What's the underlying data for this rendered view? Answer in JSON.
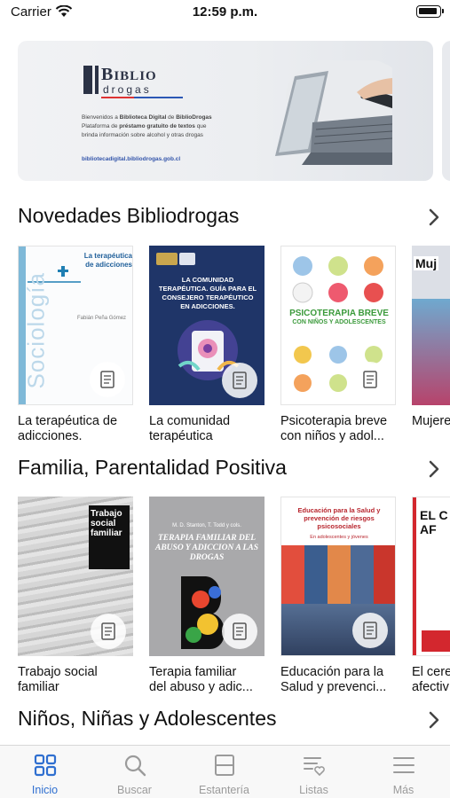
{
  "status_bar": {
    "carrier": "Carrier",
    "time": "12:59 p.m."
  },
  "banner": {
    "logo_title": "IBLIO",
    "logo_prefix": "B",
    "logo_sub": "drogas",
    "text_line1_a": "Bienvenidos a ",
    "text_line1_b": "Biblioteca Digital",
    "text_line1_c": " de ",
    "text_line1_d": "BiblioDrogas",
    "text_line2_a": "Plataforma de ",
    "text_line2_b": "préstamo gratuito de textos",
    "text_line2_c": " que",
    "text_line3": "brinda información sobre alcohol y otras drogas",
    "url": "bibliotecadigital.bibliodrogas.gob.cl"
  },
  "sections": [
    {
      "title": "Novedades Bibliodrogas",
      "books": [
        {
          "line1": "La terapéutica de",
          "line2": "adicciones.",
          "cover_title": "La terapéutica de adicciones",
          "cover_side": "Sociología",
          "cover_author": "Fabián Peña Gómez"
        },
        {
          "line1": "La comunidad",
          "line2": "terapéutica",
          "cover_title": "LA COMUNIDAD TERAPÉUTICA. GUÍA PARA EL CONSEJERO TERAPÉUTICO EN ADICCIONES."
        },
        {
          "line1": "Psicoterapia breve",
          "line2": "con niños y adol...",
          "cover_title": "PSICOTERAPIA BREVE",
          "cover_subtitle": "CON NIÑOS Y ADOLESCENTES"
        },
        {
          "line1": "Mujere",
          "line2": "",
          "cover_title": "Muj"
        }
      ]
    },
    {
      "title": "Familia, Parentalidad Positiva",
      "books": [
        {
          "line1": "Trabajo social",
          "line2": "familiar",
          "cover_title": "Trabajo social familiar"
        },
        {
          "line1": "Terapia familiar",
          "line2": "del abuso y adic...",
          "cover_title": "TERAPIA FAMILIAR DEL ABUSO Y ADICCION A LAS DROGAS",
          "cover_author": "M. D. Stanton, T. Todd y cols."
        },
        {
          "line1": "Educación para la",
          "line2": "Salud y prevenci...",
          "cover_title": "Educación para la Salud y prevención de riesgos psicosociales",
          "cover_subtitle": "En adolescentes y jóvenes"
        },
        {
          "line1": "El cere",
          "line2": "afectiv",
          "cover_title": "EL C AF"
        }
      ]
    },
    {
      "title": "Niños,  Niñas y Adolescentes"
    }
  ],
  "tabs": [
    {
      "label": "Inicio",
      "icon": "grid-icon",
      "active": true
    },
    {
      "label": "Buscar",
      "icon": "search-icon",
      "active": false
    },
    {
      "label": "Estantería",
      "icon": "shelf-icon",
      "active": false
    },
    {
      "label": "Listas",
      "icon": "list-heart-icon",
      "active": false
    },
    {
      "label": "Más",
      "icon": "menu-icon",
      "active": false
    }
  ],
  "colors": {
    "accent": "#2f6fd0",
    "inactive": "#9b9b9b"
  }
}
